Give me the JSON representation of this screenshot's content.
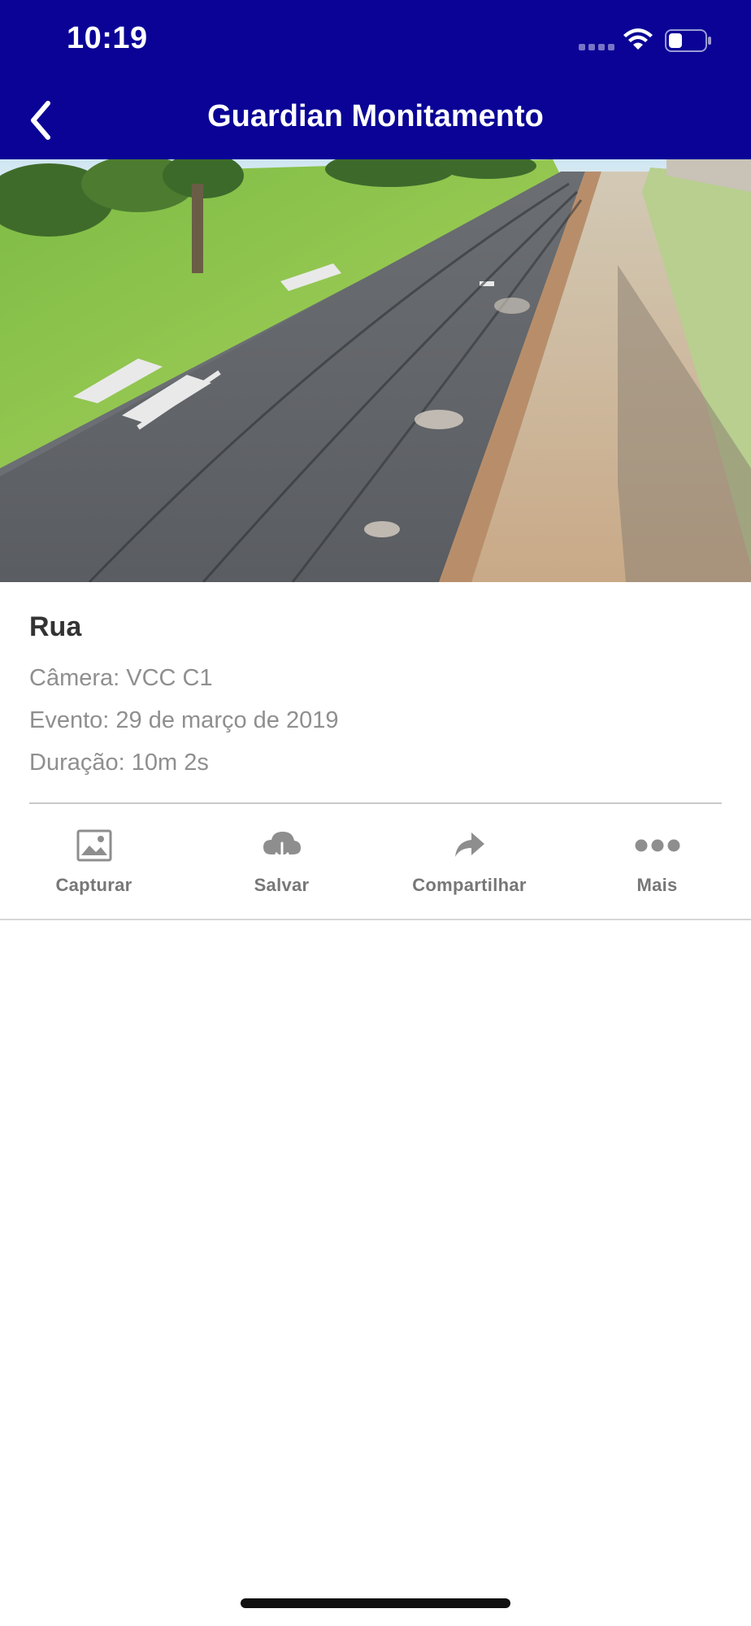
{
  "status_bar": {
    "time": "10:19",
    "icons": [
      "signal-icon",
      "wifi-icon",
      "battery-icon"
    ]
  },
  "nav": {
    "title": "Guardian Monitamento",
    "back_icon": "chevron-left-icon"
  },
  "video": {
    "description_icon": "camera-feed"
  },
  "event": {
    "title": "Rua",
    "camera": "Câmera: VCC C1",
    "date": "Evento: 29 de março de 2019",
    "duration": "Duração: 10m 2s"
  },
  "actions": [
    {
      "label": "Capturar",
      "icon": "image-icon"
    },
    {
      "label": "Salvar",
      "icon": "cloud-download-icon"
    },
    {
      "label": "Compartilhar",
      "icon": "share-icon"
    },
    {
      "label": "Mais",
      "icon": "more-icon"
    }
  ],
  "colors": {
    "header": "#0a0396",
    "icon_gray": "#8e8e8e"
  }
}
